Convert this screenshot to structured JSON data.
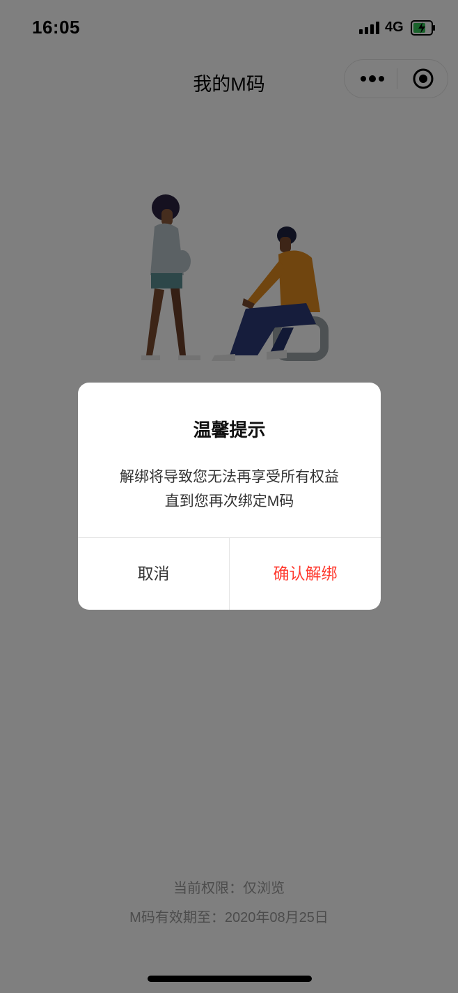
{
  "status_bar": {
    "time": "16:05",
    "network": "4G"
  },
  "nav": {
    "title": "我的M码"
  },
  "footer": {
    "permission": "当前权限：仅浏览",
    "expiry": "M码有效期至：2020年08月25日"
  },
  "dialog": {
    "title": "温馨提示",
    "message_line1": "解绑将导致您无法再享受所有权益",
    "message_line2": "直到您再次绑定M码",
    "cancel_label": "取消",
    "confirm_label": "确认解绑"
  },
  "colors": {
    "confirm": "#ff3b30",
    "battery_fill": "#34c759"
  },
  "icons": {
    "signal": "signal-bars-icon",
    "battery": "battery-charging-icon",
    "more": "more-dots-icon",
    "close": "target-close-icon"
  }
}
